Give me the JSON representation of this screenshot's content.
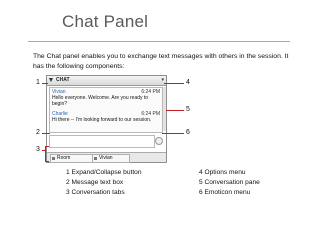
{
  "slide": {
    "title": "Chat Panel",
    "description": "The Chat panel enables you to exchange text messages with others in the session. It has the following components:"
  },
  "panel": {
    "title": "CHAT",
    "options_glyph": "▾",
    "messages": [
      {
        "sender": "Vivian",
        "time": "6:24 PM",
        "text": "Hello everyone. Welcome. Are you ready to begin?"
      },
      {
        "sender": "Charlie",
        "time": "6:24 PM",
        "text": "Hi there -- I'm looking forward to our session."
      }
    ],
    "tabs": [
      {
        "label": "Room"
      },
      {
        "label": "Vivian"
      }
    ]
  },
  "callouts": [
    "1",
    "2",
    "3",
    "4",
    "5",
    "6"
  ],
  "legend": {
    "left": [
      "1 Expand/Collapse button",
      "2 Message text box",
      "3 Conversation tabs"
    ],
    "right": [
      "4 Options menu",
      "5 Conversation pane",
      "6 Emoticon menu"
    ]
  },
  "colors": {
    "rule": "#c7a08a",
    "callout_line": "#c02020",
    "title": "#5a5a5a"
  }
}
